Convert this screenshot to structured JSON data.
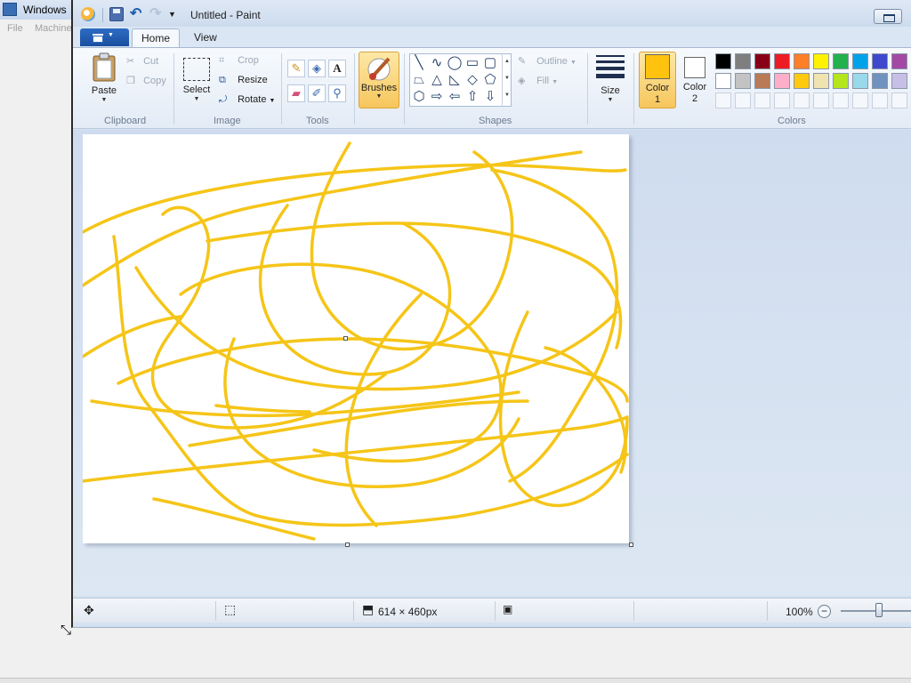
{
  "host": {
    "title": "Windows",
    "menu": [
      "File",
      "Machine"
    ]
  },
  "window": {
    "title": "Untitled - Paint"
  },
  "tabs": [
    {
      "label": "Home",
      "active": true
    },
    {
      "label": "View",
      "active": false
    }
  ],
  "ribbon": {
    "clipboard": {
      "group_label": "Clipboard",
      "paste": "Paste",
      "cut": "Cut",
      "copy": "Copy"
    },
    "image": {
      "group_label": "Image",
      "select": "Select",
      "crop": "Crop",
      "resize": "Resize",
      "rotate": "Rotate"
    },
    "tools": {
      "group_label": "Tools",
      "icons": [
        "pencil-icon",
        "fill-bucket-icon",
        "text-icon",
        "eraser-icon",
        "color-picker-icon",
        "magnifier-icon"
      ]
    },
    "brushes": {
      "label": "Brushes"
    },
    "shapes": {
      "group_label": "Shapes",
      "outline": "Outline",
      "fill": "Fill"
    },
    "size": {
      "label": "Size"
    },
    "colors": {
      "group_label": "Colors",
      "color1_label": "Color",
      "color1_num": "1",
      "color1_value": "#ffc20e",
      "color2_label": "Color",
      "color2_num": "2",
      "color2_value": "#ffffff",
      "palette_row1": [
        "#000000",
        "#7f7f7f",
        "#880015",
        "#ed1c24",
        "#ff7f27",
        "#fff200",
        "#22b14c",
        "#00a2e8",
        "#3f48cc",
        "#a349a4"
      ],
      "palette_row2": [
        "#ffffff",
        "#c3c3c3",
        "#b97a57",
        "#ffaec9",
        "#ffc90e",
        "#efe4b0",
        "#b5e61d",
        "#99d9ea",
        "#7092be",
        "#c8bfe7"
      ],
      "palette_row3_count": 10
    }
  },
  "canvas": {
    "stroke_color": "#f5c518"
  },
  "status": {
    "canvas_size": "614 × 460px",
    "zoom": "100%",
    "zoom_level_fraction": 0.5
  }
}
